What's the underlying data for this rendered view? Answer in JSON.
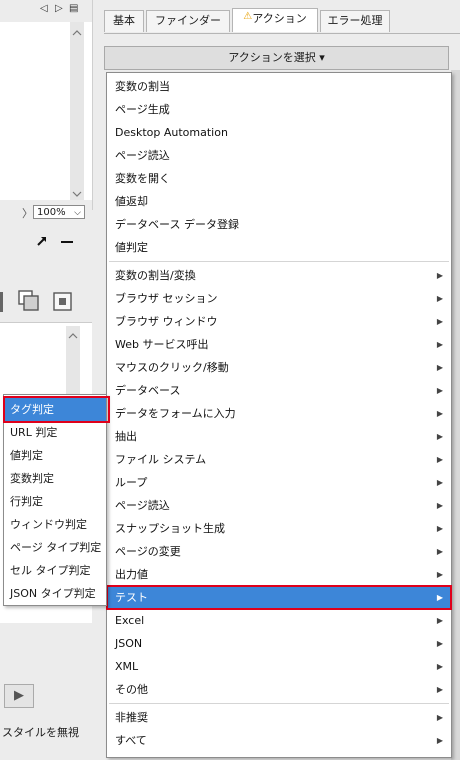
{
  "left_panel": {
    "nav_prev": "◁",
    "nav_next": "▷",
    "nav_doc": "▤",
    "zoom_prev": "〉",
    "zoom_value": "100%",
    "ignore_style": "スタイルを無視"
  },
  "tabs": [
    {
      "label": "基本"
    },
    {
      "label": "ファインダー"
    },
    {
      "label": "アクション",
      "warning_icon": "⚠"
    },
    {
      "label": "エラー処理"
    }
  ],
  "action_select": {
    "label": "アクションを選択",
    "caret": "▾"
  },
  "menu_group1": [
    "変数の割当",
    "ページ生成",
    "Desktop Automation",
    "ページ読込",
    "変数を開く",
    "値返却",
    "データベース データ登録",
    "値判定"
  ],
  "menu_group2": [
    "変数の割当/変換",
    "ブラウザ セッション",
    "ブラウザ ウィンドウ",
    "Web サービス呼出",
    "マウスのクリック/移動",
    "データベース",
    "データをフォームに入力",
    "抽出",
    "ファイル システム",
    "ループ",
    "ページ読込",
    "スナップショット生成",
    "ページの変更",
    "出力値",
    "テスト",
    "Excel",
    "JSON",
    "XML",
    "その他"
  ],
  "menu_group3": [
    "非推奨",
    "すべて"
  ],
  "selected_menu_item": "テスト",
  "submenu": [
    "タグ判定",
    "URL 判定",
    "値判定",
    "変数判定",
    "行判定",
    "ウィンドウ判定",
    "ページ タイプ判定",
    "セル タイプ判定",
    "JSON タイプ判定"
  ],
  "selected_submenu_item": "タグ判定",
  "colors": {
    "highlight": "#3d86d8",
    "annotation": "#e0001b"
  }
}
